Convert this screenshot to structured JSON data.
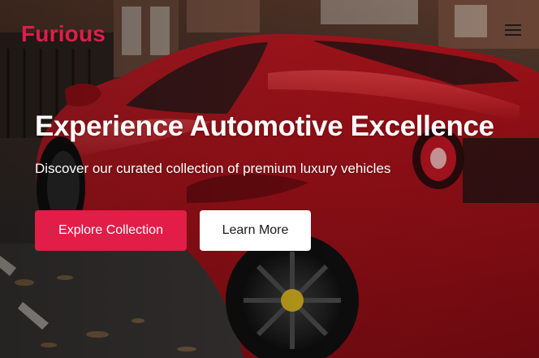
{
  "brand": {
    "name": "Furious",
    "accent_color": "#e11d48"
  },
  "nav": {
    "menu_icon": "hamburger-menu-icon"
  },
  "hero": {
    "title": "Experience Automotive Excellence",
    "subtitle": "Discover our curated collection of premium luxury vehicles",
    "primary_button": "Explore Collection",
    "secondary_button": "Learn More",
    "image_subject": "red sports car parked on a city street"
  }
}
